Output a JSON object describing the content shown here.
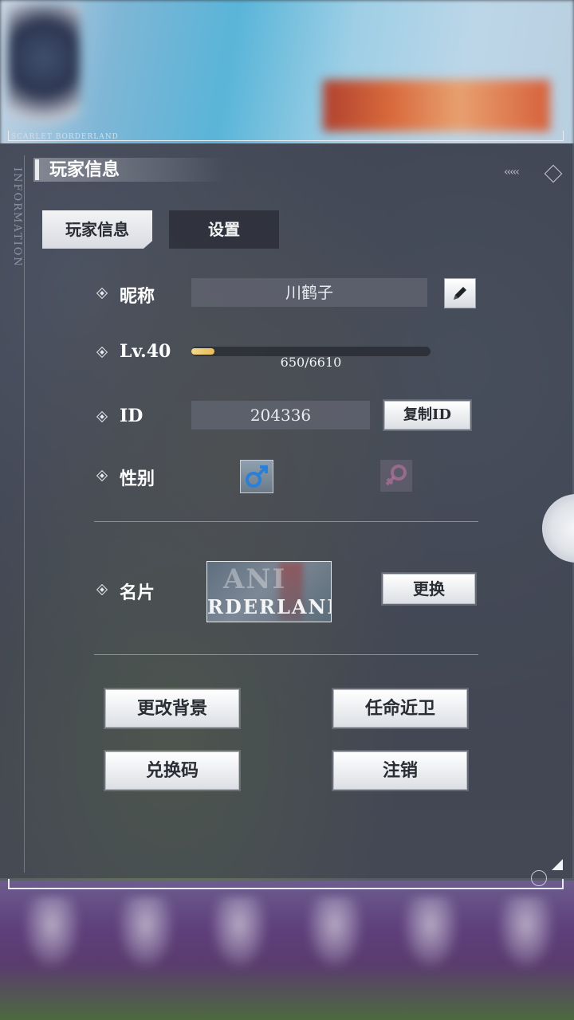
{
  "brand": {
    "text": "SCARLET BORDERLAND",
    "vertical_text": "INFORMATION"
  },
  "panel": {
    "title": "玩家信息"
  },
  "tabs": [
    {
      "label": "玩家信息",
      "active": true
    },
    {
      "label": "设置",
      "active": false
    }
  ],
  "nickname": {
    "label": "昵称",
    "value": "川鹤子",
    "edit_icon": "pencil-icon"
  },
  "level": {
    "label": "Lv.40",
    "xp_current": 650,
    "xp_max": 6610,
    "xp_text": "650/6610",
    "fill_fraction": 0.098
  },
  "id": {
    "label": "ID",
    "value": "204336",
    "copy_label": "复制ID"
  },
  "gender": {
    "label": "性别",
    "selected": "male",
    "male_icon": "male-symbol-icon",
    "female_icon": "female-symbol-icon"
  },
  "namecard": {
    "label": "名片",
    "card_text_top": "ANI",
    "card_text_bottom": "RDERLAND",
    "change_label": "更换"
  },
  "actions": {
    "change_background": "更改背景",
    "appoint_guard": "任命近卫",
    "redeem_code": "兑换码",
    "logout": "注销"
  },
  "colors": {
    "panel_bg": "#3a3e4a",
    "button_light": "#f2f3f5",
    "xp_fill": "#e8be58",
    "text_primary": "#ffffff"
  }
}
